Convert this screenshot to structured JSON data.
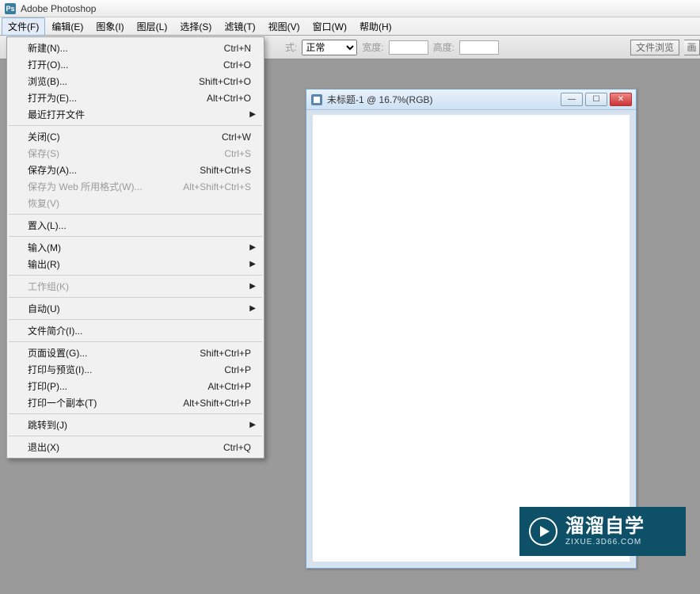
{
  "title": "Adobe Photoshop",
  "menu": {
    "file": "文件(F)",
    "edit": "编辑(E)",
    "image": "图象(I)",
    "layer": "图层(L)",
    "select": "选择(S)",
    "filter": "滤镜(T)",
    "view": "视图(V)",
    "window": "窗口(W)",
    "help": "帮助(H)"
  },
  "file_menu": {
    "new": "新建(N)...",
    "new_k": "Ctrl+N",
    "open": "打开(O)...",
    "open_k": "Ctrl+O",
    "browse": "浏览(B)...",
    "browse_k": "Shift+Ctrl+O",
    "openas": "打开为(E)...",
    "openas_k": "Alt+Ctrl+O",
    "recent": "最近打开文件",
    "close": "关闭(C)",
    "close_k": "Ctrl+W",
    "save": "保存(S)",
    "save_k": "Ctrl+S",
    "saveas": "保存为(A)...",
    "saveas_k": "Shift+Ctrl+S",
    "saveweb": "保存为 Web 所用格式(W)...",
    "saveweb_k": "Alt+Shift+Ctrl+S",
    "revert": "恢复(V)",
    "place": "置入(L)...",
    "import": "输入(M)",
    "export": "输出(R)",
    "workgroup": "工作组(K)",
    "automate": "自动(U)",
    "fileinfo": "文件简介(I)...",
    "pagesetup": "页面设置(G)...",
    "pagesetup_k": "Shift+Ctrl+P",
    "printpreview": "打印与预览(I)...",
    "printpreview_k": "Ctrl+P",
    "print": "打印(P)...",
    "print_k": "Alt+Ctrl+P",
    "printone": "打印一个副本(T)",
    "printone_k": "Alt+Shift+Ctrl+P",
    "jumpto": "跳转到(J)",
    "exit": "退出(X)",
    "exit_k": "Ctrl+Q"
  },
  "options": {
    "style_label": "式:",
    "style_value": "正常",
    "width_label": "宽度:",
    "height_label": "高度:",
    "browse_btn": "文件浏览",
    "draw_btn": "画"
  },
  "doc": {
    "title": "未标题-1 @ 16.7%(RGB)"
  },
  "watermark": {
    "big": "溜溜自学",
    "small": "ZIXUE.3D66.COM"
  }
}
